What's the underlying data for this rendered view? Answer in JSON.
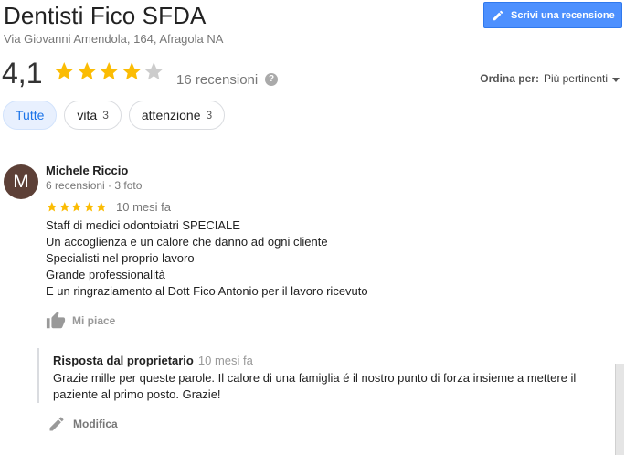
{
  "header": {
    "business_name": "Dentisti Fico SFDA",
    "address": "Via Giovanni Amendola, 164, Afragola NA",
    "write_review_label": "Scrivi una recensione"
  },
  "rating": {
    "value_text": "4,1",
    "value": 4.1,
    "max": 5,
    "reviews_count_text": "16 recensioni",
    "help_glyph": "?"
  },
  "sort": {
    "label": "Ordina per:",
    "value": "Più pertinenti"
  },
  "filters": [
    {
      "label": "Tutte",
      "count": "",
      "active": true
    },
    {
      "label": "vita",
      "count": "3",
      "active": false
    },
    {
      "label": "attenzione",
      "count": "3",
      "active": false
    }
  ],
  "review": {
    "avatar_letter": "M",
    "avatar_color": "#5d4037",
    "author": "Michele Riccio",
    "author_meta": "6 recensioni · 3 foto",
    "stars": 5,
    "date": "10 mesi fa",
    "text_lines": [
      "Staff di medici odontoiatri SPECIALE",
      "Un accoglienza e un calore che danno ad ogni cliente",
      "Specialisti nel proprio lavoro",
      "Grande professionalità",
      "E un ringraziamento al Dott Fico Antonio per il lavoro ricevuto"
    ],
    "like_label": "Mi piace",
    "like_icon": "thumbs-up-icon"
  },
  "owner_reply": {
    "title": "Risposta dal proprietario",
    "date": "10 mesi fa",
    "text": "Grazie mille per queste parole. Il calore di una famiglia é il nostro punto di forza insieme a mettere il paziente al primo posto. Grazie!",
    "edit_label": "Modifica",
    "edit_icon": "pencil-icon"
  },
  "colors": {
    "accent": "#4d90fe",
    "star": "#fbbc04",
    "star_empty": "#cccccc",
    "chip_active_bg": "#e8f0fe",
    "chip_active_text": "#1a73e8"
  }
}
